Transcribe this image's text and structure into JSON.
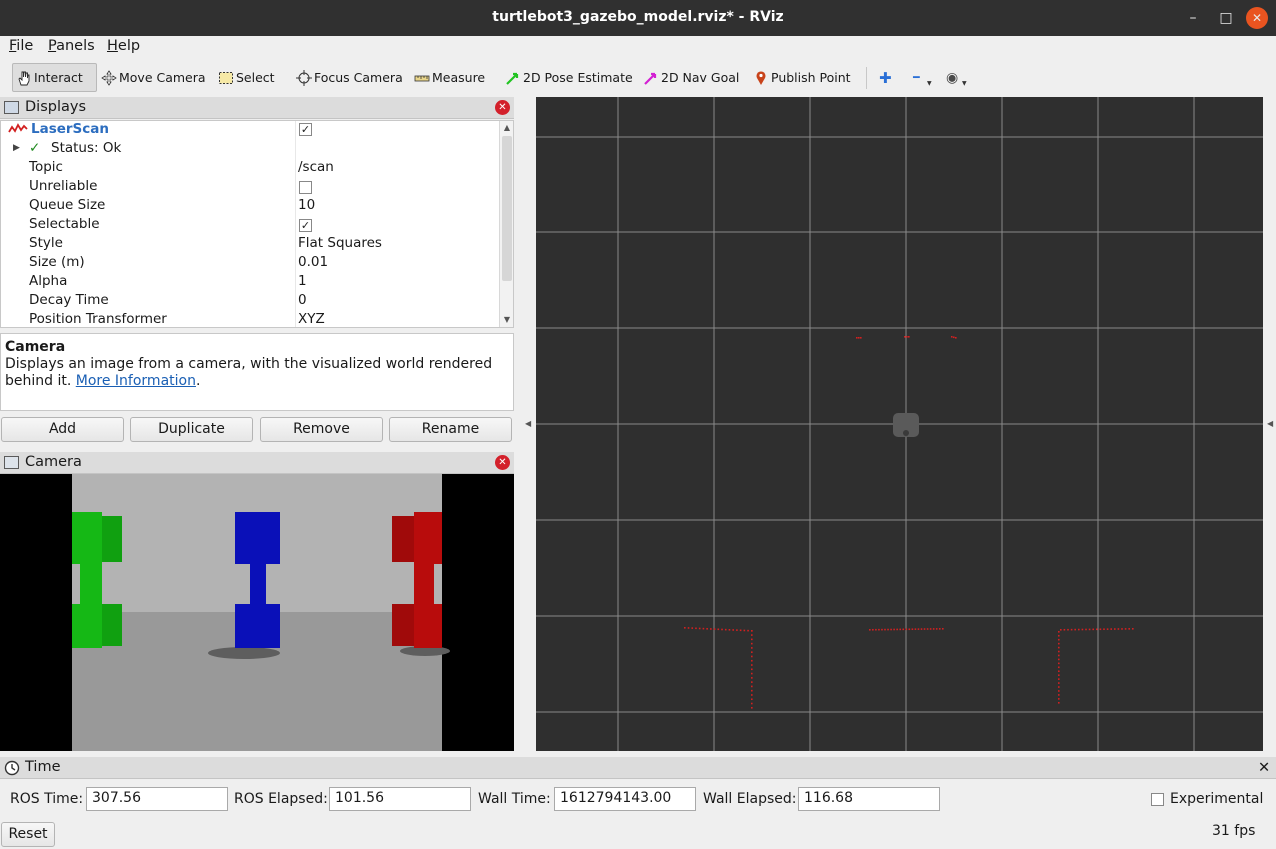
{
  "window": {
    "title": "turtlebot3_gazebo_model.rviz* - RViz",
    "minimize": "–",
    "maximize": "□",
    "close": "✕"
  },
  "menu": [
    "File",
    "Panels",
    "Help"
  ],
  "toolbar": {
    "tools": [
      {
        "label": "Interact",
        "icon": "hand-icon"
      },
      {
        "label": "Move Camera",
        "icon": "move-camera-icon"
      },
      {
        "label": "Select",
        "icon": "select-icon"
      },
      {
        "label": "Focus Camera",
        "icon": "focus-camera-icon"
      },
      {
        "label": "Measure",
        "icon": "ruler-icon"
      },
      {
        "label": "2D Pose Estimate",
        "icon": "pose-arrow-icon"
      },
      {
        "label": "2D Nav Goal",
        "icon": "nav-goal-arrow-icon"
      },
      {
        "label": "Publish Point",
        "icon": "map-pin-icon"
      }
    ],
    "active_tool": "Interact",
    "plus_glyph": "✚",
    "minus_glyph": "━",
    "eye_glyph": "◉"
  },
  "displays_panel": {
    "title": "Displays",
    "rows": [
      {
        "key": "LaserScan",
        "value": "",
        "checked": true
      },
      {
        "key": "Status: Ok",
        "value": ""
      },
      {
        "key": "Topic",
        "value": "/scan"
      },
      {
        "key": "Unreliable",
        "value": "",
        "checked": false
      },
      {
        "key": "Queue Size",
        "value": "10"
      },
      {
        "key": "Selectable",
        "value": "",
        "checked": true
      },
      {
        "key": "Style",
        "value": "Flat Squares"
      },
      {
        "key": "Size (m)",
        "value": "0.01"
      },
      {
        "key": "Alpha",
        "value": "1"
      },
      {
        "key": "Decay Time",
        "value": "0"
      },
      {
        "key": "Position Transformer",
        "value": "XYZ"
      }
    ]
  },
  "description": {
    "title": "Camera",
    "text": "Displays an image from a camera, with the visualized world rendered behind it.",
    "link": "More Information",
    "suffix": "."
  },
  "buttons": {
    "add": "Add",
    "duplicate": "Duplicate",
    "remove": "Remove",
    "rename": "Rename"
  },
  "camera_panel": {
    "title": "Camera"
  },
  "colors": {
    "laser": "#d22020",
    "grid": "#8a8a8a",
    "background_3d": "#2f2f2f",
    "green_object": "#15b815",
    "blue_object": "#0a10b8",
    "red_object": "#b80c0c"
  },
  "time_panel": {
    "title": "Time",
    "ros_time_label": "ROS Time:",
    "ros_time": "307.56",
    "ros_elapsed_label": "ROS Elapsed:",
    "ros_elapsed": "101.56",
    "wall_time_label": "Wall Time:",
    "wall_time": "1612794143.00",
    "wall_elapsed_label": "Wall Elapsed:",
    "wall_elapsed": "116.68",
    "experimental_label": "Experimental",
    "experimental_checked": false,
    "reset_label": "Reset",
    "fps": "31 fps"
  }
}
